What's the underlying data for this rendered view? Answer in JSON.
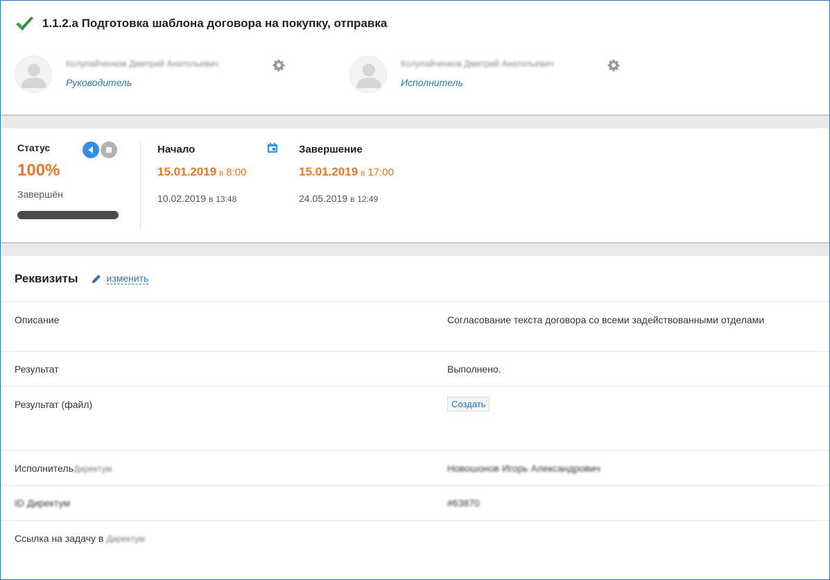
{
  "task": {
    "title": "1.1.2.а Подготовка шаблона договора на покупку, отправка"
  },
  "people": [
    {
      "name": "Колупайченков Дмитрий Анатольевич",
      "role": "Руководитель"
    },
    {
      "name": "Колупайченков Дмитрий Анатольевич",
      "role": "Исполнитель"
    }
  ],
  "status": {
    "label": "Статус",
    "percent": "100%",
    "state": "Завершён",
    "progress_fraction": 1.0
  },
  "dates": {
    "start": {
      "label": "Начало",
      "plan_date": "15.01.2019",
      "plan_sep": "в",
      "plan_time": "8:00",
      "fact_date": "10.02.2019",
      "fact_sep": "в",
      "fact_time": "13:48"
    },
    "end": {
      "label": "Завершение",
      "plan_date": "15.01.2019",
      "plan_sep": "в",
      "plan_time": "17:00",
      "fact_date": "24.05.2019",
      "fact_sep": "в",
      "fact_time": "12:49"
    }
  },
  "requisites": {
    "title": "Реквизиты",
    "edit_label": "изменить",
    "rows": {
      "description": {
        "label": "Описание",
        "value": "Согласование текста договора со всеми задействованными отделами"
      },
      "result": {
        "label": "Результат",
        "value": "Выполнено."
      },
      "result_file": {
        "label": "Результат (файл)",
        "button": "Создать"
      },
      "executor": {
        "label": "Исполнитель",
        "label_blurred": "Директум",
        "value": "Новошонов Игорь Александрович"
      },
      "id": {
        "label_blurred": "ID Директум",
        "value": "#63870"
      },
      "link": {
        "label": "Ссылка на задачу в",
        "label_blurred": "Директум"
      }
    }
  },
  "colors": {
    "accent_orange": "#f07522",
    "link_blue": "#2e75b6",
    "check_green": "#3aa54a"
  }
}
